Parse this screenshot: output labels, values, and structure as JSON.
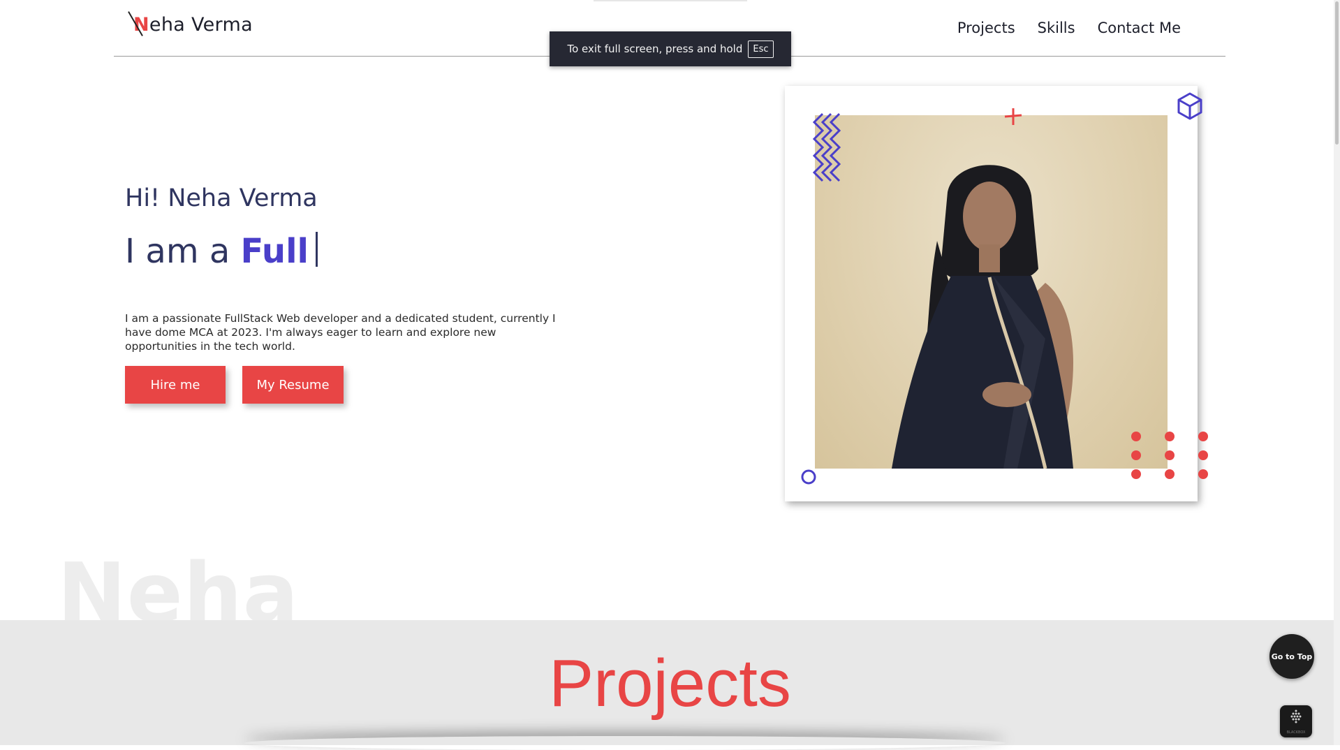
{
  "header": {
    "logo_initial": "N",
    "logo_rest": "eha Verma",
    "nav": [
      {
        "label": "Projects"
      },
      {
        "label": "Skills"
      },
      {
        "label": "Contact Me"
      }
    ]
  },
  "fullscreen_toast": {
    "message": "To exit full screen, press and hold",
    "key": "Esc"
  },
  "hero": {
    "greeting": "Hi! Neha Verma",
    "role_prefix": "I am a",
    "role_typed": "Full",
    "about": "I am a passionate FullStack Web developer and a dedicated student, currently I have dome MCA at 2023. I'm always eager to learn and explore new opportunities in the tech world.",
    "hire_label": "Hire me",
    "resume_label": "My Resume"
  },
  "watermark": "Neha",
  "projects": {
    "title": "Projects"
  },
  "floating": {
    "goto_top_label": "Go to Top",
    "blackbox_label": "BLACKBOX"
  },
  "colors": {
    "accent_red": "#e84545",
    "accent_indigo": "#4a3fc9",
    "text_dark": "#2f3560"
  },
  "icons": [
    "cube-icon",
    "plus-icon",
    "zigzag-icon",
    "circle-icon",
    "dots-pattern"
  ]
}
